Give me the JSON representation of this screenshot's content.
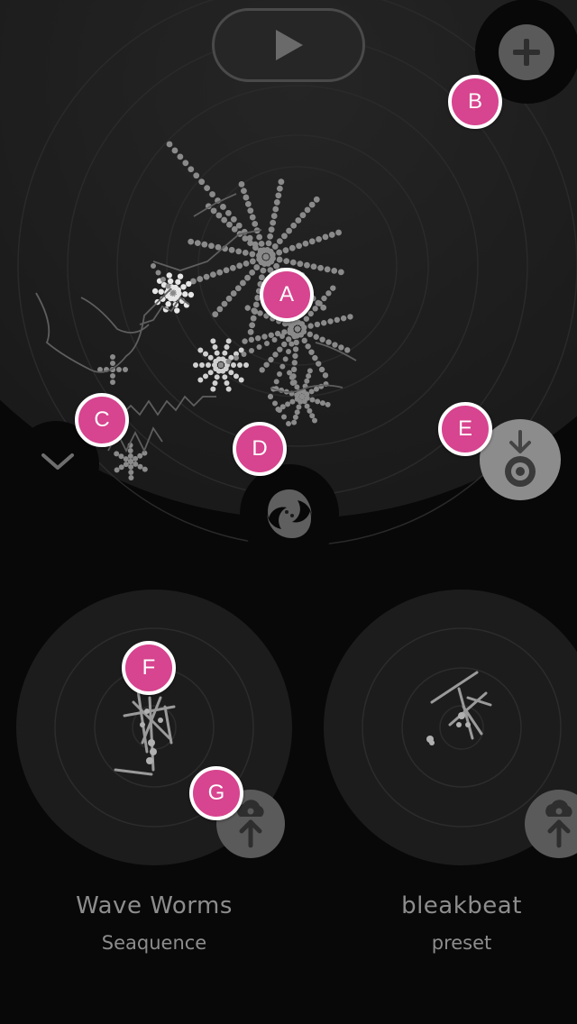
{
  "toolbar": {
    "play_icon": "play-icon",
    "add_icon": "plus-icon",
    "collapse_icon": "chevron-down-icon",
    "logo_icon": "app-logo-icon",
    "download_icon": "download-to-target-icon"
  },
  "presets": [
    {
      "title": "Wave Worms",
      "subtitle": "Seaquence",
      "action_icon": "cloud-upload-icon"
    },
    {
      "title": "bleakbeat",
      "subtitle": "preset",
      "action_icon": "cloud-upload-icon"
    }
  ],
  "markers": [
    {
      "label": "A"
    },
    {
      "label": "B"
    },
    {
      "label": "C"
    },
    {
      "label": "D"
    },
    {
      "label": "E"
    },
    {
      "label": "F"
    },
    {
      "label": "G"
    }
  ],
  "colors": {
    "background": "#080808",
    "stage": "#1b1b1b",
    "marker": "#d7448f",
    "creature": "#8a8a8a",
    "text": "#8d8d8d"
  }
}
